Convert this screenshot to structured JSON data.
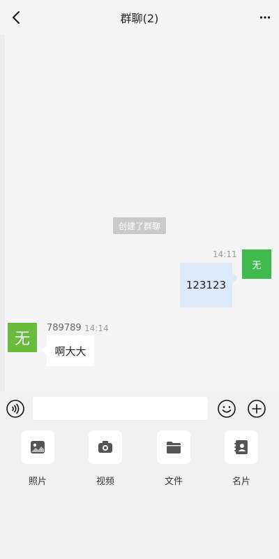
{
  "header": {
    "title": "群聊(2)",
    "back_icon": "chevron-left-icon",
    "more_icon": "more-horizontal-icon"
  },
  "chat": {
    "system_message": "创建了群聊",
    "outgoing": {
      "time": "14:11",
      "avatar_text": "无",
      "text": "123123",
      "avatar_color": "#41b94d",
      "bubble_color": "#dbe9fb"
    },
    "incoming": {
      "avatar_text": "无",
      "sender": "789789",
      "time": "14:14",
      "text": "啊大大",
      "avatar_color": "#68bc3d"
    }
  },
  "input_bar": {
    "voice_icon": "voice-icon",
    "input_value": "",
    "emoji_icon": "emoji-icon",
    "plus_icon": "plus-icon"
  },
  "tools": [
    {
      "label": "照片",
      "icon": "photo-icon"
    },
    {
      "label": "视频",
      "icon": "camera-icon"
    },
    {
      "label": "文件",
      "icon": "folder-icon"
    },
    {
      "label": "名片",
      "icon": "contact-card-icon"
    }
  ]
}
